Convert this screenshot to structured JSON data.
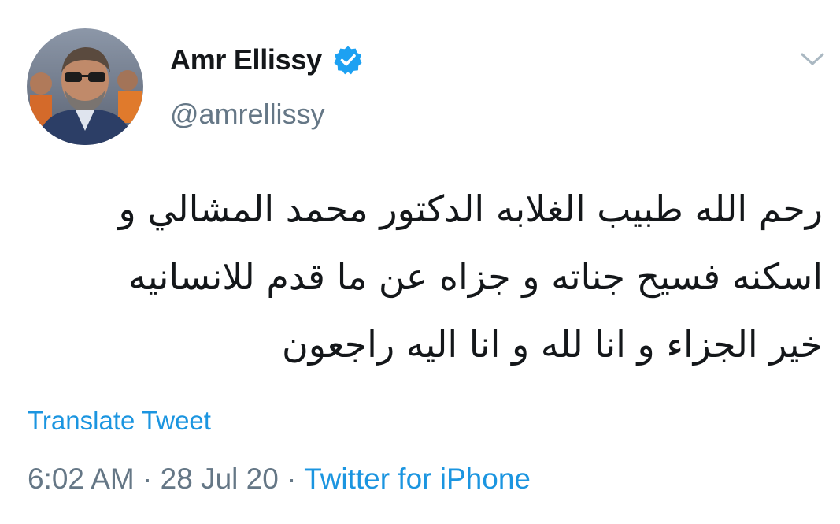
{
  "user": {
    "display_name": "Amr Ellissy",
    "handle": "@amrellissy",
    "verified": true
  },
  "tweet": {
    "text_lines": [
      "رحم الله طبيب الغلابه الدكتور محمد المشالي و",
      "اسكنه فسيح جناته و جزاه عن ما قدم للانسانيه",
      "خير الجزاء و انا لله و انا اليه راجعون"
    ],
    "translate_label": "Translate Tweet",
    "time": "6:02 AM",
    "date": "28 Jul 20",
    "separator": "·",
    "source": "Twitter for iPhone"
  },
  "colors": {
    "accent": "#1b95e0",
    "muted": "#657786",
    "text": "#14171a",
    "verified": "#1da1f2"
  },
  "icons": {
    "verified": "verified-badge-icon",
    "menu": "chevron-down-icon"
  }
}
